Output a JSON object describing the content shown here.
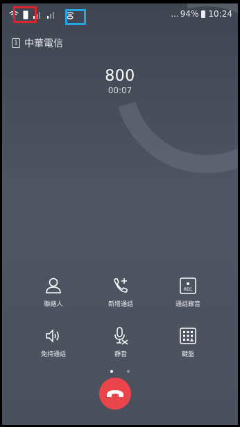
{
  "status_bar": {
    "more_indicator": "...",
    "battery_percent": "94%",
    "time": "10:24",
    "icons": [
      "wifi-icon",
      "sim-slot-icon",
      "signal-strength-icon",
      "signal-strength-icon",
      "hotspot-icon",
      "battery-icon"
    ]
  },
  "call": {
    "carrier_slot": "1",
    "carrier_name": "中華電信",
    "number": "800",
    "duration": "00:07"
  },
  "controls": {
    "row1": [
      {
        "label": "聯絡人",
        "icon": "person-icon"
      },
      {
        "label": "新增通話",
        "icon": "add-call-icon"
      },
      {
        "label": "通話錄音",
        "icon": "record-icon",
        "icon_text": "REC"
      }
    ],
    "row2": [
      {
        "label": "免持通話",
        "icon": "speaker-icon"
      },
      {
        "label": "靜音",
        "icon": "mute-mic-icon"
      },
      {
        "label": "鍵盤",
        "icon": "keypad-icon"
      }
    ]
  },
  "pager": {
    "pages": 2,
    "active": 0
  },
  "end_call": {
    "icon": "end-call-icon",
    "color": "#e8444a"
  },
  "colors": {
    "highlight_red": "#e0222a",
    "highlight_blue": "#1fa7e6"
  }
}
